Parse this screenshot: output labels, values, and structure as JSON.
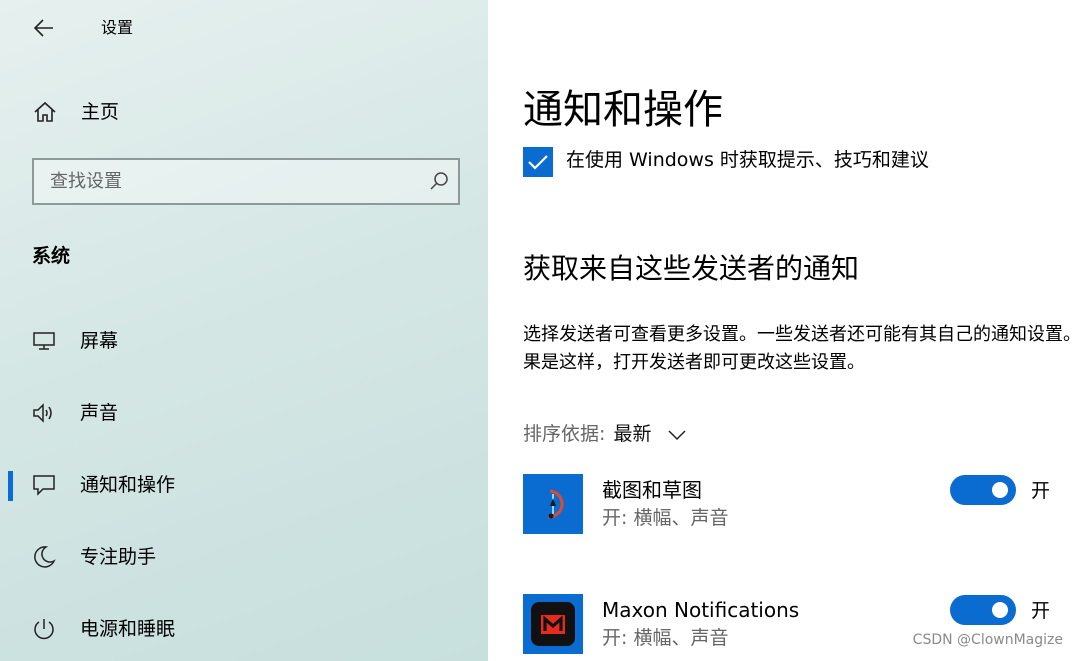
{
  "window": {
    "title": "设置"
  },
  "sidebar": {
    "home_label": "主页",
    "search_placeholder": "查找设置",
    "section_title": "系统",
    "items": [
      {
        "label": "屏幕",
        "icon": "monitor-icon",
        "active": false
      },
      {
        "label": "声音",
        "icon": "speaker-icon",
        "active": false
      },
      {
        "label": "通知和操作",
        "icon": "notification-icon",
        "active": true
      },
      {
        "label": "专注助手",
        "icon": "moon-icon",
        "active": false
      },
      {
        "label": "电源和睡眠",
        "icon": "power-icon",
        "active": false
      }
    ]
  },
  "main": {
    "title": "通知和操作",
    "tips_checkbox": {
      "label": "在使用 Windows 时获取提示、技巧和建议",
      "checked": true
    },
    "senders_heading": "获取来自这些发送者的通知",
    "description": "选择发送者可查看更多设置。一些发送者还可能有其自己的通知设置。如\n果是这样，打开发送者即可更改这些设置。",
    "sort": {
      "label": "排序依据:",
      "value": "最新"
    },
    "apps": [
      {
        "name": "截图和草图",
        "status": "开: 横幅、声音",
        "toggle_label": "开",
        "on": true,
        "icon": "snip-sketch-icon"
      },
      {
        "name": "Maxon Notifications",
        "status": "开: 横幅、声音",
        "toggle_label": "开",
        "on": true,
        "icon": "maxon-icon"
      }
    ]
  },
  "watermark": "CSDN @ClownMagize",
  "colors": {
    "accent": "#0a6bd1",
    "sidebar_bg": "#d5e7e5"
  }
}
